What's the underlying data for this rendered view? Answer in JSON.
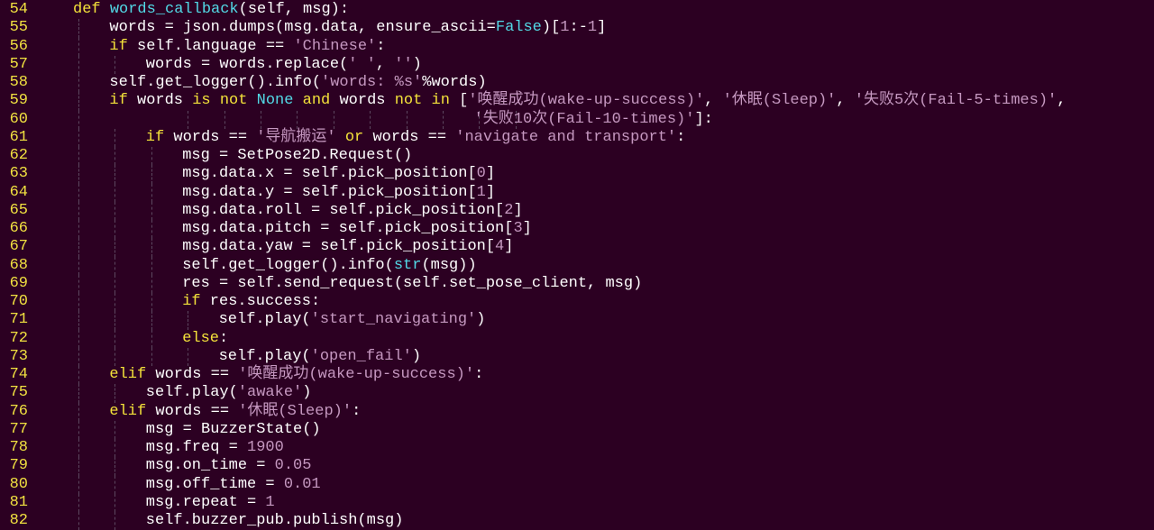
{
  "editor": {
    "background": "#2c0022",
    "colors": {
      "line_number": "#f0e040",
      "plain": "#ffffff",
      "kw": "#f4e23a",
      "fn": "#52d9e6",
      "builtin": "#52d9e6",
      "const": "#52d9e6",
      "str": "#c598c0",
      "num": "#c598c0",
      "indent_guide": "#5c4860"
    },
    "lines": [
      {
        "n": "54",
        "indent": 1,
        "tokens": [
          [
            "kw",
            "def"
          ],
          [
            "plain",
            " "
          ],
          [
            "fn",
            "words_callback"
          ],
          [
            "plain",
            "(self, msg):"
          ]
        ]
      },
      {
        "n": "55",
        "indent": 2,
        "tokens": [
          [
            "plain",
            "words = json.dumps(msg.data, ensure_ascii="
          ],
          [
            "const",
            "False"
          ],
          [
            "plain",
            ")["
          ],
          [
            "num",
            "1"
          ],
          [
            "plain",
            ":-"
          ],
          [
            "num",
            "1"
          ],
          [
            "plain",
            "]"
          ]
        ]
      },
      {
        "n": "56",
        "indent": 2,
        "tokens": [
          [
            "kw",
            "if"
          ],
          [
            "plain",
            " self.language == "
          ],
          [
            "str",
            "'Chinese'"
          ],
          [
            "plain",
            ":"
          ]
        ]
      },
      {
        "n": "57",
        "indent": 3,
        "tokens": [
          [
            "plain",
            "words = words.replace("
          ],
          [
            "str",
            "' '"
          ],
          [
            "plain",
            ", "
          ],
          [
            "str",
            "''"
          ],
          [
            "plain",
            ")"
          ]
        ]
      },
      {
        "n": "58",
        "indent": 2,
        "tokens": [
          [
            "plain",
            "self.get_logger().info("
          ],
          [
            "str",
            "'words: %s'"
          ],
          [
            "plain",
            "%words)"
          ]
        ]
      },
      {
        "n": "59",
        "indent": 2,
        "tokens": [
          [
            "kw",
            "if"
          ],
          [
            "plain",
            " words "
          ],
          [
            "kw",
            "is not"
          ],
          [
            "plain",
            " "
          ],
          [
            "const",
            "None"
          ],
          [
            "plain",
            " "
          ],
          [
            "kw",
            "and"
          ],
          [
            "plain",
            " words "
          ],
          [
            "kw",
            "not in"
          ],
          [
            "plain",
            " ["
          ],
          [
            "str",
            "'唤醒成功(wake-up-success)'"
          ],
          [
            "plain",
            ", "
          ],
          [
            "str",
            "'休眠(Sleep)'"
          ],
          [
            "plain",
            ", "
          ],
          [
            "str",
            "'失败5次(Fail-5-times)'"
          ],
          [
            "plain",
            ","
          ]
        ]
      },
      {
        "n": "60",
        "indent": 2,
        "extra_guides": [
          4,
          5,
          6,
          7,
          8,
          9,
          10,
          11,
          12,
          13
        ],
        "pad": 43,
        "tokens": [
          [
            "str",
            "'失败10次(Fail-10-times)'"
          ],
          [
            "plain",
            "]:"
          ]
        ]
      },
      {
        "n": "61",
        "indent": 3,
        "tokens": [
          [
            "kw",
            "if"
          ],
          [
            "plain",
            " words == "
          ],
          [
            "str",
            "'导航搬运'"
          ],
          [
            "plain",
            " "
          ],
          [
            "kw",
            "or"
          ],
          [
            "plain",
            " words == "
          ],
          [
            "str",
            "'navigate and transport'"
          ],
          [
            "plain",
            ":"
          ]
        ]
      },
      {
        "n": "62",
        "indent": 4,
        "tokens": [
          [
            "plain",
            "msg = SetPose2D.Request()"
          ]
        ]
      },
      {
        "n": "63",
        "indent": 4,
        "tokens": [
          [
            "plain",
            "msg.data.x = self.pick_position["
          ],
          [
            "num",
            "0"
          ],
          [
            "plain",
            "]"
          ]
        ]
      },
      {
        "n": "64",
        "indent": 4,
        "tokens": [
          [
            "plain",
            "msg.data.y = self.pick_position["
          ],
          [
            "num",
            "1"
          ],
          [
            "plain",
            "]"
          ]
        ]
      },
      {
        "n": "65",
        "indent": 4,
        "tokens": [
          [
            "plain",
            "msg.data.roll = self.pick_position["
          ],
          [
            "num",
            "2"
          ],
          [
            "plain",
            "]"
          ]
        ]
      },
      {
        "n": "66",
        "indent": 4,
        "tokens": [
          [
            "plain",
            "msg.data.pitch = self.pick_position["
          ],
          [
            "num",
            "3"
          ],
          [
            "plain",
            "]"
          ]
        ]
      },
      {
        "n": "67",
        "indent": 4,
        "tokens": [
          [
            "plain",
            "msg.data.yaw = self.pick_position["
          ],
          [
            "num",
            "4"
          ],
          [
            "plain",
            "]"
          ]
        ]
      },
      {
        "n": "68",
        "indent": 4,
        "tokens": [
          [
            "plain",
            "self.get_logger().info("
          ],
          [
            "builtin",
            "str"
          ],
          [
            "plain",
            "(msg))"
          ]
        ]
      },
      {
        "n": "69",
        "indent": 4,
        "tokens": [
          [
            "plain",
            "res = self.send_request(self.set_pose_client, msg)"
          ]
        ]
      },
      {
        "n": "70",
        "indent": 4,
        "tokens": [
          [
            "kw",
            "if"
          ],
          [
            "plain",
            " res.success:"
          ]
        ]
      },
      {
        "n": "71",
        "indent": 5,
        "tokens": [
          [
            "plain",
            "self.play("
          ],
          [
            "str",
            "'start_navigating'"
          ],
          [
            "plain",
            ")"
          ]
        ]
      },
      {
        "n": "72",
        "indent": 4,
        "tokens": [
          [
            "kw",
            "else"
          ],
          [
            "plain",
            ":"
          ]
        ]
      },
      {
        "n": "73",
        "indent": 5,
        "tokens": [
          [
            "plain",
            "self.play("
          ],
          [
            "str",
            "'open_fail'"
          ],
          [
            "plain",
            ")"
          ]
        ]
      },
      {
        "n": "74",
        "indent": 2,
        "tokens": [
          [
            "kw",
            "elif"
          ],
          [
            "plain",
            " words == "
          ],
          [
            "str",
            "'唤醒成功(wake-up-success)'"
          ],
          [
            "plain",
            ":"
          ]
        ]
      },
      {
        "n": "75",
        "indent": 3,
        "tokens": [
          [
            "plain",
            "self.play("
          ],
          [
            "str",
            "'awake'"
          ],
          [
            "plain",
            ")"
          ]
        ]
      },
      {
        "n": "76",
        "indent": 2,
        "tokens": [
          [
            "kw",
            "elif"
          ],
          [
            "plain",
            " words == "
          ],
          [
            "str",
            "'休眠(Sleep)'"
          ],
          [
            "plain",
            ":"
          ]
        ]
      },
      {
        "n": "77",
        "indent": 3,
        "tokens": [
          [
            "plain",
            "msg = BuzzerState()"
          ]
        ]
      },
      {
        "n": "78",
        "indent": 3,
        "tokens": [
          [
            "plain",
            "msg.freq = "
          ],
          [
            "num",
            "1900"
          ]
        ]
      },
      {
        "n": "79",
        "indent": 3,
        "tokens": [
          [
            "plain",
            "msg.on_time = "
          ],
          [
            "num",
            "0.05"
          ]
        ]
      },
      {
        "n": "80",
        "indent": 3,
        "tokens": [
          [
            "plain",
            "msg.off_time = "
          ],
          [
            "num",
            "0.01"
          ]
        ]
      },
      {
        "n": "81",
        "indent": 3,
        "tokens": [
          [
            "plain",
            "msg.repeat = "
          ],
          [
            "num",
            "1"
          ]
        ]
      },
      {
        "n": "82",
        "indent": 3,
        "tokens": [
          [
            "plain",
            "self.buzzer_pub.publish(msg)"
          ]
        ]
      }
    ]
  }
}
